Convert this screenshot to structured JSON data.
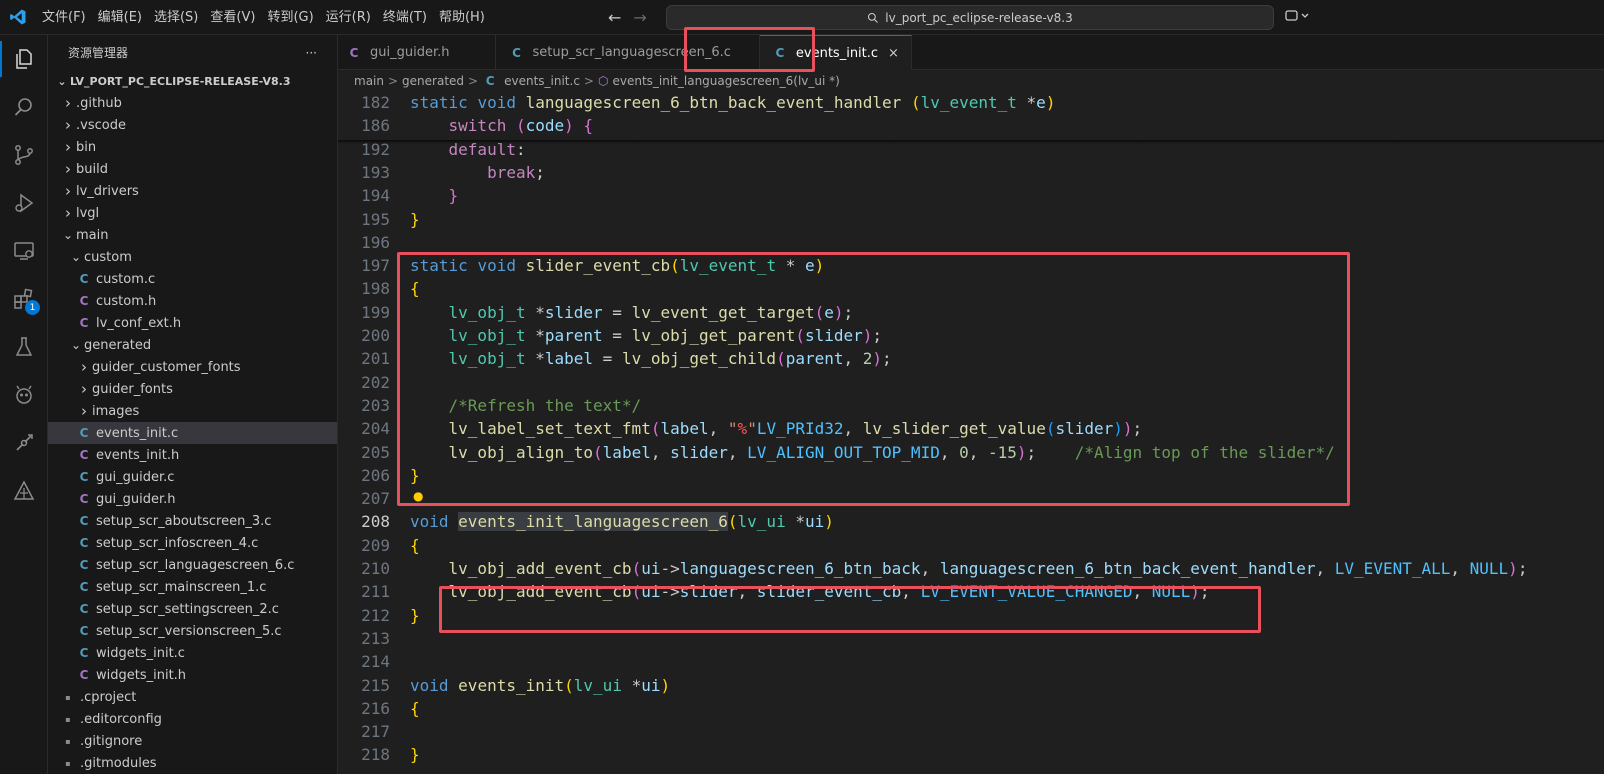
{
  "title_bar": {
    "menu": [
      "文件(F)",
      "编辑(E)",
      "选择(S)",
      "查看(V)",
      "转到(G)",
      "运行(R)",
      "终端(T)",
      "帮助(H)"
    ],
    "back_icon": "arrow-left-icon",
    "forward_icon": "arrow-right-icon",
    "search_text": "lv_port_pc_eclipse-release-v8.3"
  },
  "activity_bar": {
    "items": [
      "explorer-icon",
      "search-icon",
      "source-control-icon",
      "run-debug-icon",
      "remote-explorer-icon",
      "extensions-icon",
      "testing-icon",
      "platformio-icon",
      "git-graph-icon",
      "gui-guider-icon"
    ],
    "extensions_badge": "1"
  },
  "sidebar": {
    "title": "资源管理器",
    "more": "···",
    "root": "LV_PORT_PC_ECLIPSE-RELEASE-V8.3",
    "tree": [
      {
        "label": ".github",
        "depth": 1,
        "kind": "folder",
        "open": false
      },
      {
        "label": ".vscode",
        "depth": 1,
        "kind": "folder",
        "open": false
      },
      {
        "label": "bin",
        "depth": 1,
        "kind": "folder",
        "open": false
      },
      {
        "label": "build",
        "depth": 1,
        "kind": "folder",
        "open": false
      },
      {
        "label": "lv_drivers",
        "depth": 1,
        "kind": "folder",
        "open": false
      },
      {
        "label": "lvgl",
        "depth": 1,
        "kind": "folder",
        "open": false
      },
      {
        "label": "main",
        "depth": 1,
        "kind": "folder",
        "open": true
      },
      {
        "label": "custom",
        "depth": 2,
        "kind": "folder",
        "open": true
      },
      {
        "label": "custom.c",
        "depth": 3,
        "kind": "c"
      },
      {
        "label": "custom.h",
        "depth": 3,
        "kind": "h"
      },
      {
        "label": "lv_conf_ext.h",
        "depth": 3,
        "kind": "h"
      },
      {
        "label": "generated",
        "depth": 2,
        "kind": "folder",
        "open": true
      },
      {
        "label": "guider_customer_fonts",
        "depth": 3,
        "kind": "folder",
        "open": false
      },
      {
        "label": "guider_fonts",
        "depth": 3,
        "kind": "folder",
        "open": false
      },
      {
        "label": "images",
        "depth": 3,
        "kind": "folder",
        "open": false
      },
      {
        "label": "events_init.c",
        "depth": 3,
        "kind": "c",
        "selected": true
      },
      {
        "label": "events_init.h",
        "depth": 3,
        "kind": "h"
      },
      {
        "label": "gui_guider.c",
        "depth": 3,
        "kind": "c"
      },
      {
        "label": "gui_guider.h",
        "depth": 3,
        "kind": "h"
      },
      {
        "label": "setup_scr_aboutscreen_3.c",
        "depth": 3,
        "kind": "c"
      },
      {
        "label": "setup_scr_infoscreen_4.c",
        "depth": 3,
        "kind": "c"
      },
      {
        "label": "setup_scr_languagescreen_6.c",
        "depth": 3,
        "kind": "c"
      },
      {
        "label": "setup_scr_mainscreen_1.c",
        "depth": 3,
        "kind": "c"
      },
      {
        "label": "setup_scr_settingscreen_2.c",
        "depth": 3,
        "kind": "c"
      },
      {
        "label": "setup_scr_versionscreen_5.c",
        "depth": 3,
        "kind": "c"
      },
      {
        "label": "widgets_init.c",
        "depth": 3,
        "kind": "c"
      },
      {
        "label": "widgets_init.h",
        "depth": 3,
        "kind": "h"
      },
      {
        "label": ".cproject",
        "depth": 1,
        "kind": "file"
      },
      {
        "label": ".editorconfig",
        "depth": 1,
        "kind": "file"
      },
      {
        "label": ".gitignore",
        "depth": 1,
        "kind": "file"
      },
      {
        "label": ".gitmodules",
        "depth": 1,
        "kind": "file"
      }
    ]
  },
  "tabs": [
    {
      "label": "gui_guider.h",
      "kind": "h",
      "active": false
    },
    {
      "label": "setup_scr_languagescreen_6.c",
      "kind": "c",
      "active": false
    },
    {
      "label": "events_init.c",
      "kind": "c",
      "active": true
    }
  ],
  "tab_close": "×",
  "breadcrumb": {
    "items": [
      "main",
      "generated",
      "events_init.c",
      "events_init_languagescreen_6(lv_ui *)"
    ],
    "separator": ">"
  },
  "colors": {
    "accent": "#0078d4",
    "highlight_box": "#e8505b",
    "c_icon": "#519aba",
    "h_icon": "#a074c4"
  },
  "code": [
    {
      "ln": "182",
      "sticky": true,
      "html": "<span class='kw'>static</span> <span class='kw'>void</span> <span class='fn'>languagescreen_6_btn_back_event_handler</span> <span class='p1'>(</span><span class='ty'>lv_event_t</span> *<span class='var'>e</span><span class='p1'>)</span>"
    },
    {
      "ln": "186",
      "sticky": true,
      "html": "    <span class='ctl'>switch</span> <span class='p2'>(</span><span class='var'>code</span><span class='p2'>)</span> <span class='p2'>{</span>"
    },
    {
      "ln": "192",
      "html": "    <span class='ctl'>default</span>:"
    },
    {
      "ln": "193",
      "html": "        <span class='ctl'>break</span>;"
    },
    {
      "ln": "194",
      "html": "    <span class='p2'>}</span>"
    },
    {
      "ln": "195",
      "html": "<span class='p1'>}</span>"
    },
    {
      "ln": "196",
      "html": ""
    },
    {
      "ln": "197",
      "html": "<span class='kw'>static</span> <span class='kw'>void</span> <span class='fn'>slider_event_cb</span><span class='p1'>(</span><span class='ty'>lv_event_t</span> * <span class='var'>e</span><span class='p1'>)</span>"
    },
    {
      "ln": "198",
      "html": "<span class='p1'>{</span>"
    },
    {
      "ln": "199",
      "html": "    <span class='ty'>lv_obj_t</span> *<span class='var'>slider</span> = <span class='fn'>lv_event_get_target</span><span class='p2'>(</span><span class='var'>e</span><span class='p2'>)</span>;"
    },
    {
      "ln": "200",
      "html": "    <span class='ty'>lv_obj_t</span> *<span class='var'>parent</span> = <span class='fn'>lv_obj_get_parent</span><span class='p2'>(</span><span class='var'>slider</span><span class='p2'>)</span>;"
    },
    {
      "ln": "201",
      "html": "    <span class='ty'>lv_obj_t</span> *<span class='var'>label</span> = <span class='fn'>lv_obj_get_child</span><span class='p2'>(</span><span class='var'>parent</span>, <span class='num'>2</span><span class='p2'>)</span>;"
    },
    {
      "ln": "202",
      "html": ""
    },
    {
      "ln": "203",
      "html": "    <span class='cm'>/*Refresh the text*/</span>"
    },
    {
      "ln": "204",
      "html": "    <span class='fn'>lv_label_set_text_fmt</span><span class='p2'>(</span><span class='var'>label</span>, <span class='str'>\"</span><span class='esc'>%</span><span class='str'>\"</span><span class='mac'>LV_PRId32</span>, <span class='fn'>lv_slider_get_value</span><span class='p3'>(</span><span class='var'>slider</span><span class='p3'>)</span><span class='p2'>)</span>;"
    },
    {
      "ln": "205",
      "html": "    <span class='fn'>lv_obj_align_to</span><span class='p2'>(</span><span class='var'>label</span>, <span class='var'>slider</span>, <span class='mac'>LV_ALIGN_OUT_TOP_MID</span>, <span class='num'>0</span>, <span class='num'>-15</span><span class='p2'>)</span>;    <span class='cm'>/*Align top of the slider*/</span>"
    },
    {
      "ln": "206",
      "html": "<span class='p1'>}</span>"
    },
    {
      "ln": "207",
      "html": ""
    },
    {
      "ln": "208",
      "current": true,
      "html": "<span class='kw'>void</span> <span class='fn hl'>events_init_languagescreen_6</span><span class='p1'>(</span><span class='ty'>lv_ui</span> *<span class='var'>ui</span><span class='p1'>)</span>"
    },
    {
      "ln": "209",
      "html": "<span class='p1'>{</span>"
    },
    {
      "ln": "210",
      "html": "    <span class='fn'>lv_obj_add_event_cb</span><span class='p2'>(</span><span class='var'>ui</span>-><span class='var'>languagescreen_6_btn_back</span>, <span class='var'>languagescreen_6_btn_back_event_handler</span>, <span class='mac'>LV_EVENT_ALL</span>, <span class='mac'>NULL</span><span class='p2'>)</span>;"
    },
    {
      "ln": "211",
      "html": "    <span class='fn'>lv_obj_add_event_cb</span><span class='p2'>(</span><span class='var'>ui</span>-><span class='var'>slider</span>, <span class='var'>slider_event_cb</span>, <span class='mac'>LV_EVENT_VALUE_CHANGED</span>, <span class='mac'>NULL</span><span class='p2'>)</span>;"
    },
    {
      "ln": "212",
      "html": "<span class='p1'>}</span>"
    },
    {
      "ln": "213",
      "html": ""
    },
    {
      "ln": "214",
      "html": ""
    },
    {
      "ln": "215",
      "html": "<span class='kw'>void</span> <span class='fn'>events_init</span><span class='p1'>(</span><span class='ty'>lv_ui</span> *<span class='var'>ui</span><span class='p1'>)</span>"
    },
    {
      "ln": "216",
      "html": "<span class='p1'>{</span>"
    },
    {
      "ln": "217",
      "html": ""
    },
    {
      "ln": "218",
      "html": "<span class='p1'>}</span>"
    }
  ]
}
